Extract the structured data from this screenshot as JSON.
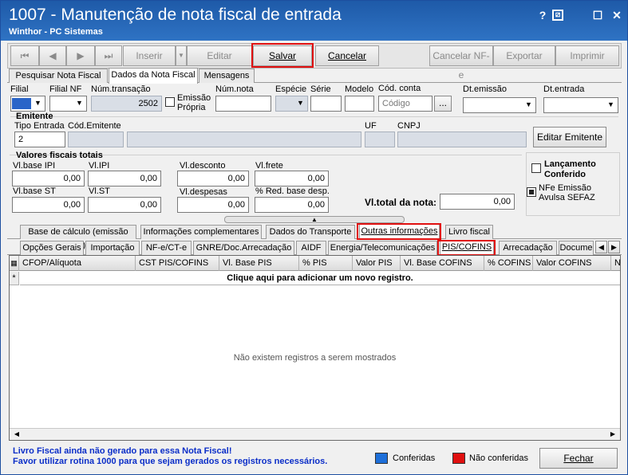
{
  "window": {
    "title": "1007 - Manutenção de nota fiscal de entrada",
    "subtitle": "Winthor - PC Sistemas",
    "help_btn": "?",
    "minimize_btn": "_",
    "close_btn": "✕"
  },
  "toolbar": {
    "first": "⏮",
    "prev": "◀",
    "next": "▶",
    "last": "⏭",
    "inserir": "Inserir",
    "editar": "Editar",
    "salvar": "Salvar",
    "cancelar": "Cancelar",
    "cancelar_nfe": "Cancelar NF-e",
    "exportar": "Exportar",
    "imprimir": "Imprimir"
  },
  "main_tabs": [
    "Pesquisar Nota Fiscal",
    "Dados da Nota Fiscal",
    "Mensagens"
  ],
  "fields": {
    "filial": "Filial",
    "filial_nf": "Filial NF",
    "num_transacao": "Núm.transação",
    "num_transacao_value": "2502",
    "emissao_propria_1": "Emissão",
    "emissao_propria_2": "Própria",
    "num_nota": "Núm.nota",
    "especie": "Espécie",
    "serie": "Série",
    "modelo": "Modelo",
    "cod_conta": "Cód. conta",
    "cod_conta_placeholder": "Código",
    "cod_conta_btn": "...",
    "dt_emissao": "Dt.emissão",
    "dt_entrada": "Dt.entrada"
  },
  "emitente": {
    "group": "Emitente",
    "tipo_entrada": "Tipo Entrada",
    "tipo_entrada_value": "2",
    "cod_emitente": "Cód.Emitente",
    "uf": "UF",
    "cnpj": "CNPJ",
    "editar_btn": "Editar Emitente"
  },
  "valores": {
    "group": "Valores fiscais totais",
    "vl_base_ipi": "Vl.base IPI",
    "vl_base_ipi_value": "0,00",
    "vl_ipi": "Vl.IPI",
    "vl_ipi_value": "0,00",
    "vl_desconto": "Vl.desconto",
    "vl_desconto_value": "0,00",
    "vl_frete": "Vl.frete",
    "vl_frete_value": "0,00",
    "vl_base_st": "Vl.base ST",
    "vl_base_st_value": "0,00",
    "vl_st": "Vl.ST",
    "vl_st_value": "0,00",
    "vl_despesas": "Vl.despesas",
    "vl_despesas_value": "0,00",
    "red_base_desp": "% Red. base desp.",
    "red_base_desp_value": "0,00",
    "vl_total": "Vl.total da nota:",
    "vl_total_value": "0,00"
  },
  "side": {
    "lancamento_1": "Lançamento",
    "lancamento_2": "Conferido",
    "nfe_avulsa_1": "NFe Emissão",
    "nfe_avulsa_2": "Avulsa SEFAZ"
  },
  "sub_tabs_1": [
    "Base de cálculo (emissão NF)",
    "Informações complementares",
    "Dados do Transporte",
    "Outras informações",
    "Livro fiscal"
  ],
  "sub_tabs_2": [
    "Opções Gerais",
    "Importação",
    "NF-e/CT-e",
    "GNRE/Doc.Arrecadação",
    "AIDF",
    "Energia/Telecomunicações",
    "PIS/COFINS",
    "Arrecadação",
    "Docume"
  ],
  "grid": {
    "columns": [
      "CFOP/Alíquota",
      "CST PIS/COFINS",
      "Vl. Base PIS",
      "% PIS",
      "Valor PIS",
      "Vl. Base COFINS",
      "% COFINS",
      "Valor COFINS",
      "N"
    ],
    "new_row_marker": "*",
    "add_row_text": "Clique aqui para adicionar um novo registro.",
    "empty_text": "Não existem registros a serem mostrados"
  },
  "footer": {
    "msg1": "Livro Fiscal ainda não gerado para essa Nota Fiscal!",
    "msg2": "Favor utilizar rotina 1000 para que sejam gerados os registros necessários.",
    "legend_conferidas": "Conferidas",
    "legend_nao_conferidas": "Não conferidas",
    "fechar": "Fechar",
    "color_conferidas": "#1e6fd9",
    "color_nao_conferidas": "#e01010"
  }
}
